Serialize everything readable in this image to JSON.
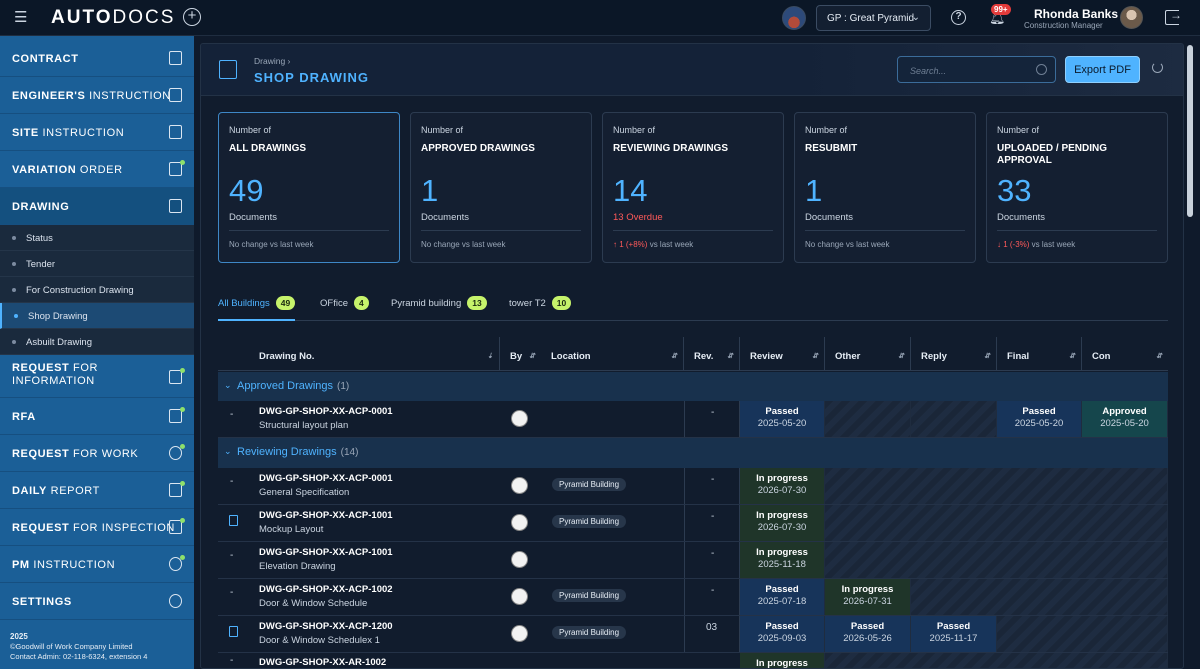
{
  "app": {
    "logo_bold": "AUTO",
    "logo_thin": "DOCS"
  },
  "topbar": {
    "project": "GP : Great Pyramid",
    "notifications": "99+",
    "user_name": "Rhonda Banks",
    "user_role": "Construction Manager"
  },
  "sidebar": {
    "items": [
      {
        "bold": "CONTRACT",
        "thin": ""
      },
      {
        "bold": "ENGINEER'S",
        "thin": " INSTRUCTION"
      },
      {
        "bold": "SITE",
        "thin": " INSTRUCTION"
      },
      {
        "bold": "VARIATION",
        "thin": " ORDER"
      },
      {
        "bold": "DRAWING",
        "thin": ""
      },
      {
        "bold": "REQUEST",
        "thin": " FOR INFORMATION"
      },
      {
        "bold": "RFA",
        "thin": ""
      },
      {
        "bold": "REQUEST",
        "thin": " FOR WORK"
      },
      {
        "bold": "DAILY",
        "thin": " REPORT"
      },
      {
        "bold": "REQUEST",
        "thin": " FOR INSPECTION"
      },
      {
        "bold": "PM",
        "thin": " INSTRUCTION"
      },
      {
        "bold": "SETTINGS",
        "thin": ""
      }
    ],
    "sub_items": [
      "Status",
      "Tender",
      "For Construction Drawing",
      "Shop Drawing",
      "Asbuilt Drawing"
    ],
    "footer": {
      "year": "2025",
      "copyright": "©Goodwill of Work Company Limited",
      "contact": "Contact Admin: 02-118-6324, extension 4"
    }
  },
  "header": {
    "breadcrumb": "Drawing ›",
    "title": "SHOP DRAWING",
    "search_placeholder": "Search...",
    "export_label": "Export PDF"
  },
  "cards": [
    {
      "pre": "Number of",
      "title": "ALL DRAWINGS",
      "value": "49",
      "sub": "Documents",
      "foot_delta": "",
      "foot": "No change vs last week"
    },
    {
      "pre": "Number of",
      "title": "APPROVED DRAWINGS",
      "value": "1",
      "sub": "Documents",
      "foot_delta": "",
      "foot": "No change vs last week"
    },
    {
      "pre": "Number of",
      "title": "REVIEWING DRAWINGS",
      "value": "14",
      "sub": "13 Overdue",
      "foot_delta": "↑ 1 (+8%)",
      "foot": " vs last week"
    },
    {
      "pre": "Number of",
      "title": "RESUBMIT",
      "value": "1",
      "sub": "Documents",
      "foot_delta": "",
      "foot": "No change vs last week"
    },
    {
      "pre": "Number of",
      "title": "UPLOADED / PENDING APPROVAL",
      "value": "33",
      "sub": "Documents",
      "foot_delta": "↓ 1 (-3%)",
      "foot": " vs last week"
    }
  ],
  "tabs": [
    {
      "label": "All Buildings",
      "count": "49"
    },
    {
      "label": "OFfice",
      "count": "4"
    },
    {
      "label": "Pyramid building",
      "count": "13"
    },
    {
      "label": "tower T2",
      "count": "10"
    }
  ],
  "columns": [
    "Drawing No.",
    "By",
    "Location",
    "Rev.",
    "Review",
    "Other",
    "Reply",
    "Final",
    "Con"
  ],
  "groups": [
    {
      "label": "Approved Drawings",
      "count": "(1)"
    },
    {
      "label": "Reviewing Drawings",
      "count": "(14)"
    }
  ],
  "rows": [
    {
      "mark": "-",
      "no": "DWG-GP-SHOP-XX-ACP-0001",
      "desc": "Structural layout plan",
      "loc": "",
      "rev": "-"
    },
    {
      "mark": "-",
      "no": "DWG-GP-SHOP-XX-ACP-0001",
      "desc": "General Specification",
      "loc": "Pyramid Building",
      "rev": "-"
    },
    {
      "mark": "",
      "no": "DWG-GP-SHOP-XX-ACP-1001",
      "desc": "Mockup Layout",
      "loc": "Pyramid Building",
      "rev": "-"
    },
    {
      "mark": "-",
      "no": "DWG-GP-SHOP-XX-ACP-1001",
      "desc": "Elevation Drawing",
      "loc": "",
      "rev": "-"
    },
    {
      "mark": "-",
      "no": "DWG-GP-SHOP-XX-ACP-1002",
      "desc": "Door & Window Schedule",
      "loc": "Pyramid Building",
      "rev": "-"
    },
    {
      "mark": "",
      "no": "DWG-GP-SHOP-XX-ACP-1200",
      "desc": "Door & Window Schedulex 1",
      "loc": "Pyramid Building",
      "rev": "03"
    },
    {
      "mark": "-",
      "no": "DWG-GP-SHOP-XX-AR-1002",
      "desc": "",
      "loc": "",
      "rev": ""
    }
  ],
  "status": {
    "r0_review": [
      "Passed",
      "2025-05-20"
    ],
    "r0_final": [
      "Passed",
      "2025-05-20"
    ],
    "r0_con": [
      "Approved",
      "2025-05-20"
    ],
    "r1_review": [
      "In progress",
      "2026-07-30"
    ],
    "r2_review": [
      "In progress",
      "2026-07-30"
    ],
    "r3_review": [
      "In progress",
      "2025-11-18"
    ],
    "r4_review": [
      "Passed",
      "2025-07-18"
    ],
    "r4_other": [
      "In progress",
      "2026-07-31"
    ],
    "r5_review": [
      "Passed",
      "2025-09-03"
    ],
    "r5_other": [
      "Passed",
      "2026-05-26"
    ],
    "r5_reply": [
      "Passed",
      "2025-11-17"
    ],
    "r6_review": [
      "In progress",
      ""
    ]
  }
}
